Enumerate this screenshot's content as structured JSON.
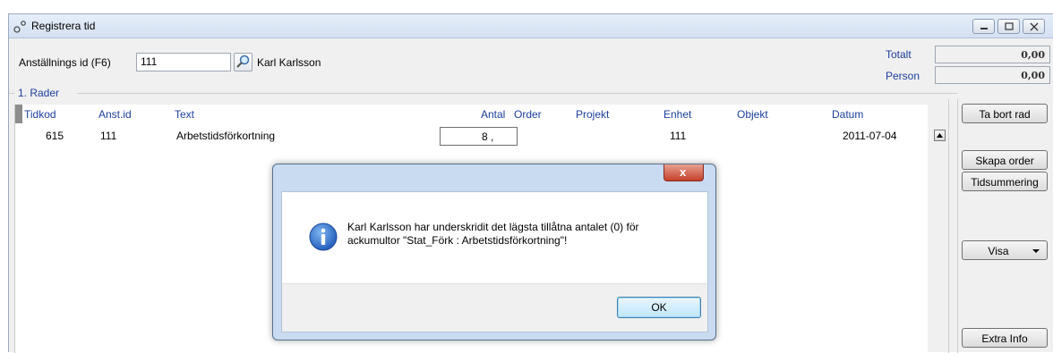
{
  "window": {
    "title": "Registrera tid",
    "icon": "gear-icon"
  },
  "header": {
    "employee_id_label": "Anställnings id (F6)",
    "employee_id_value": "111",
    "employee_name": "Karl Karlsson",
    "totalt_label": "Totalt",
    "totalt_value": "0,00",
    "person_label": "Person",
    "person_value": "0,00"
  },
  "group": {
    "title": "1. Rader"
  },
  "grid": {
    "columns": [
      "Tidkod",
      "Anst.id",
      "Text",
      "Antal",
      "Order",
      "Projekt",
      "Enhet",
      "Objekt",
      "Datum"
    ],
    "rows": [
      {
        "tidkod": "615",
        "anst_id": "111",
        "text": "Arbetstidsförkortning",
        "antal": "8  ,",
        "order": "",
        "projekt": "",
        "enhet": "111",
        "objekt": "",
        "datum": "2011-07-04"
      }
    ]
  },
  "sidebar": {
    "ta_bort_rad": "Ta bort rad",
    "skapa_order": "Skapa order",
    "tidsummering": "Tidsummering",
    "visa": "Visa",
    "extra_info": "Extra Info"
  },
  "dialog": {
    "message_line1": "Karl Karlsson har underskridit det lägsta tillåtna antalet (0) för",
    "message_line2": "ackumultor \"Stat_Förk : Arbetstidsförkortning\"!",
    "ok_label": "OK",
    "close_glyph": "x"
  },
  "colors": {
    "accent_blue": "#1c3f9e",
    "title_bar": "#dce6f4"
  }
}
